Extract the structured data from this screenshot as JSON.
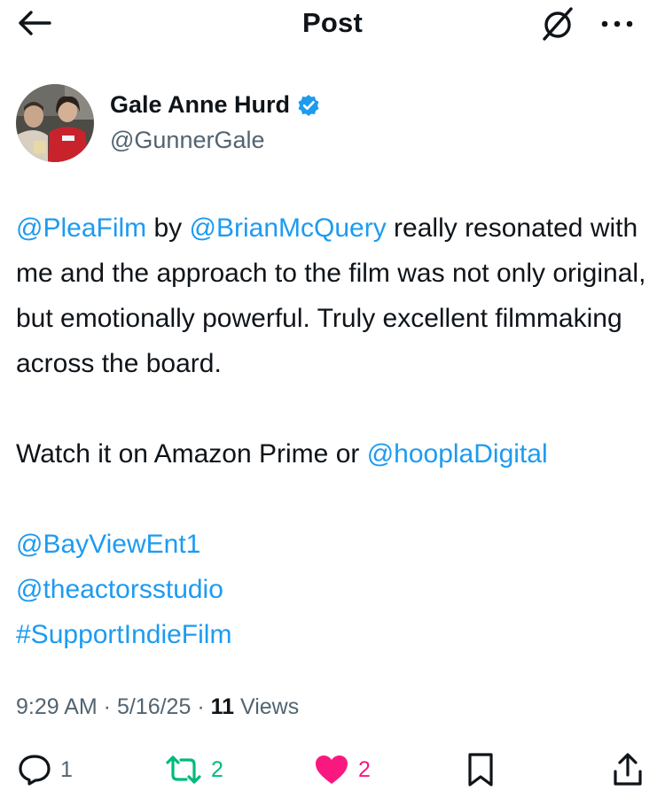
{
  "header": {
    "title": "Post"
  },
  "author": {
    "display_name": "Gale Anne Hurd",
    "handle": "@GunnerGale",
    "verified": true
  },
  "tweet": {
    "p1_mention1": "@PleaFilm",
    "p1_by": " by ",
    "p1_mention2": "@BrianMcQuery",
    "p1_rest": " really resonated with me and the approach to the film was not only original, but emotionally powerful. Truly excellent filmmaking across the board.",
    "p2_text": "Watch it on Amazon Prime or ",
    "p2_mention": "@hooplaDigital",
    "mention3": "@BayViewEnt1",
    "mention4": "@theactorsstudio",
    "hashtag": "#SupportIndieFilm"
  },
  "meta": {
    "time": "9:29 AM",
    "sep1": " · ",
    "date": "5/16/25",
    "sep2": " · ",
    "views_count": "11",
    "views_label": " Views"
  },
  "actions": {
    "replies": "1",
    "reposts": "2",
    "likes": "2"
  },
  "colors": {
    "link": "#1d9bf0",
    "secondary_text": "#536471",
    "like": "#f91880",
    "repost": "#00ba7c",
    "verified": "#1d9bf0"
  },
  "icons": {
    "back": "arrow-left-icon",
    "grok": "grok-icon",
    "more": "more-horizontal-icon",
    "verified": "verified-badge-icon",
    "reply": "reply-icon",
    "repost": "repost-icon",
    "like": "heart-filled-icon",
    "bookmark": "bookmark-icon",
    "share": "share-icon"
  }
}
